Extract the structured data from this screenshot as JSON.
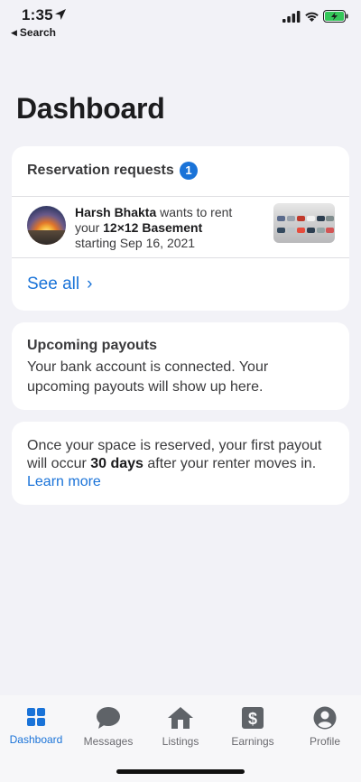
{
  "status_bar": {
    "time": "1:35",
    "back_label": "Search"
  },
  "page": {
    "title": "Dashboard"
  },
  "reservations": {
    "header": "Reservation requests",
    "badge_count": "1",
    "request": {
      "renter_name": "Harsh Bhakta",
      "text_wants": " wants to rent",
      "text_your": "your ",
      "space_name": "12×12 Basement",
      "starting": "starting Sep 16, 2021"
    },
    "see_all_label": "See all"
  },
  "payouts": {
    "title": "Upcoming payouts",
    "body": "Your bank account is connected. Your upcoming payouts will show up here."
  },
  "info": {
    "text_before": "Once your space is reserved, your first payout will occur ",
    "highlight": "30 days",
    "text_after": " after your renter moves in. ",
    "link": "Learn more"
  },
  "tabs": [
    {
      "label": "Dashboard",
      "icon": "grid-icon",
      "active": true
    },
    {
      "label": "Messages",
      "icon": "chat-bubble-icon",
      "active": false
    },
    {
      "label": "Listings",
      "icon": "house-icon",
      "active": false
    },
    {
      "label": "Earnings",
      "icon": "dollar-icon",
      "active": false
    },
    {
      "label": "Profile",
      "icon": "person-icon",
      "active": false
    }
  ],
  "colors": {
    "accent": "#1a73d8",
    "background": "#f2f2f7",
    "card": "#ffffff",
    "battery": "#34c759"
  }
}
